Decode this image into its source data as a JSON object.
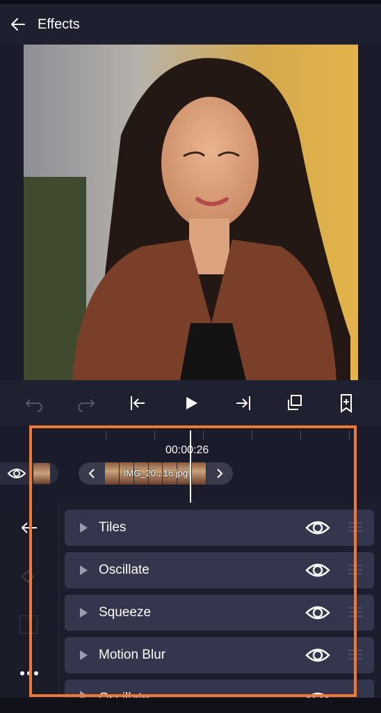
{
  "header": {
    "title": "Effects"
  },
  "timeline": {
    "timecode": "00:00:26",
    "clip_label": "IMG_20...16.jpg"
  },
  "effects": [
    {
      "label": "Tiles"
    },
    {
      "label": "Oscillate"
    },
    {
      "label": "Squeeze"
    },
    {
      "label": "Motion Blur"
    },
    {
      "label": "Oscillate"
    }
  ],
  "colors": {
    "accent": "#f27a2e",
    "background": "#1a1c2b",
    "row": "#33364c"
  }
}
